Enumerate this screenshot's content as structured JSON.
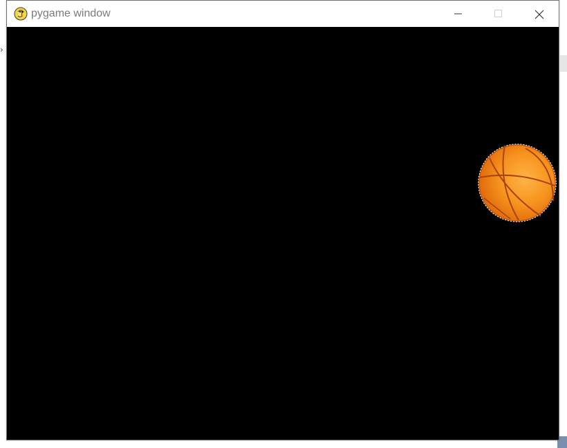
{
  "window": {
    "title": "pygame window",
    "icon": "pygame-snake-icon",
    "controls": {
      "minimize": "minimize-icon",
      "maximize": "maximize-icon",
      "close": "close-icon"
    }
  },
  "game": {
    "background_color": "#000000",
    "sprite": {
      "name": "basketball",
      "color": "#f7931e",
      "seam_color": "#a8430f"
    }
  }
}
